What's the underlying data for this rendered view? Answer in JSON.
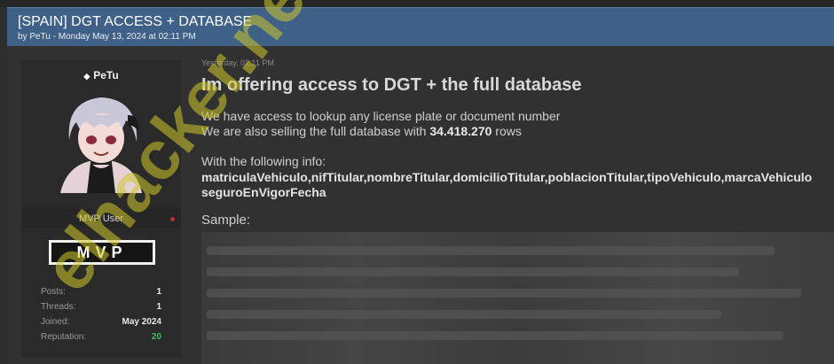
{
  "thread": {
    "title": "[SPAIN] DGT ACCESS + DATABASE",
    "byline": "by PeTu - Monday May 13, 2024 at 02:11 PM"
  },
  "author": {
    "name": "PeTu",
    "role": "MVP User",
    "badge": "MVP",
    "stats": [
      {
        "label": "Posts:",
        "value": "1"
      },
      {
        "label": "Threads:",
        "value": "1"
      },
      {
        "label": "Joined:",
        "value": "May 2024"
      },
      {
        "label": "Reputation:",
        "value": "20"
      }
    ]
  },
  "post": {
    "date": "Yesterday, 02:11 PM",
    "headline": "Im offering access to DGT + the full database",
    "line1": "We have access to lookup any license plate or document number",
    "line2_pre": "We are also selling the full database with ",
    "line2_count": "34.418.270",
    "line2_post": " rows",
    "info_label": "With the following info:",
    "fields_line1": "matriculaVehiculo,nifTitular,nombreTitular,domicilioTitular,poblacionTitular,tipoVehiculo,marcaVehiculo",
    "fields_line2": "seguroEnVigorFecha",
    "sample_label": "Sample:"
  },
  "watermark": "elhacker.net",
  "colors": {
    "header_bg": "#3f6187",
    "reputation": "#3fbf5a",
    "online": "#b93030"
  }
}
